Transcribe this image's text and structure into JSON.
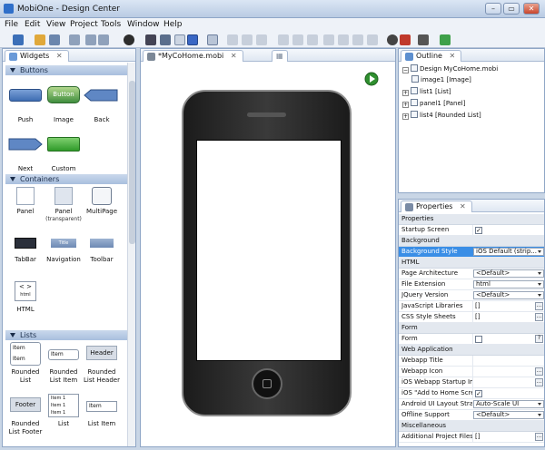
{
  "window": {
    "title": "MobiOne - Design Center"
  },
  "menu": [
    "File",
    "Edit",
    "View",
    "Project",
    "Tools",
    "Window",
    "Help"
  ],
  "widgets_panel": {
    "tab_label": "Widgets",
    "sections": {
      "buttons": {
        "label": "Buttons",
        "items": [
          {
            "label": "Push"
          },
          {
            "label": "Image",
            "thumb_text": "Button"
          },
          {
            "label": "Back"
          },
          {
            "label": "Next"
          },
          {
            "label": "Custom"
          }
        ]
      },
      "containers": {
        "label": "Containers",
        "items": [
          {
            "label": "Panel"
          },
          {
            "label": "Panel",
            "sub": "(transparent)"
          },
          {
            "label": "MultiPage"
          },
          {
            "label": "TabBar"
          },
          {
            "label": "Navigation",
            "thumb_text": "Title"
          },
          {
            "label": "Toolbar"
          },
          {
            "label": "HTML",
            "thumb_text": "< >",
            "thumb_sub": "html"
          }
        ]
      },
      "lists": {
        "label": "Lists",
        "items": [
          {
            "label": "Rounded",
            "label2": "List",
            "rows": [
              "Item",
              "Item"
            ]
          },
          {
            "label": "Rounded",
            "label2": "List Item",
            "rows": [
              "Item"
            ]
          },
          {
            "label": "Rounded",
            "label2": "List Header",
            "thumb_text": "Header"
          },
          {
            "label": "Rounded",
            "label2": "List Footer",
            "thumb_text": "Footer"
          },
          {
            "label": "List",
            "rows": [
              "Item 1",
              "Item 1",
              "Item 1"
            ]
          },
          {
            "label": "List Item",
            "rows": [
              "Item"
            ]
          }
        ]
      }
    }
  },
  "editor": {
    "tab_label": "*MyCoHome.mobi"
  },
  "outline": {
    "tab_label": "Outline",
    "root": "Design MyCoHome.mobi",
    "children": [
      "image1 [Image]",
      "list1 [List]",
      "panel1 [Panel]",
      "list4 [Rounded List]"
    ]
  },
  "properties": {
    "tab_label": "Properties",
    "groups": [
      {
        "name": "Properties",
        "rows": [
          {
            "name": "Startup Screen",
            "type": "check",
            "value": "✓"
          }
        ]
      },
      {
        "name": "Background",
        "rows": [
          {
            "name": "Background Style",
            "type": "dropdown",
            "value": "iOS Default (strip...",
            "selected": true
          }
        ]
      },
      {
        "name": "HTML",
        "rows": [
          {
            "name": "Page Architecture",
            "type": "dropdown",
            "value": "<Default>"
          },
          {
            "name": "File Extension",
            "type": "dropdown",
            "value": "html"
          },
          {
            "name": "JQuery Version",
            "type": "dropdown",
            "value": "<Default>"
          },
          {
            "name": "JavaScript Libraries",
            "type": "ellipsis",
            "value": "[]"
          },
          {
            "name": "CSS Style Sheets",
            "type": "ellipsis",
            "value": "[]"
          }
        ]
      },
      {
        "name": "Form",
        "rows": [
          {
            "name": "Form",
            "type": "check-help",
            "value": ""
          }
        ]
      },
      {
        "name": "Web Application",
        "rows": [
          {
            "name": "Webapp Title",
            "type": "text",
            "value": ""
          },
          {
            "name": "Webapp Icon",
            "type": "ellipsis",
            "value": ""
          },
          {
            "name": "iOS Webapp Startup Im",
            "type": "ellipsis",
            "value": ""
          },
          {
            "name": "iOS \"Add to Home Scre",
            "type": "check",
            "value": "✓"
          },
          {
            "name": "Android UI Layout Strat",
            "type": "dropdown",
            "value": "Auto-Scale UI"
          },
          {
            "name": "Offline Support",
            "type": "dropdown",
            "value": "<Default>"
          }
        ]
      },
      {
        "name": "Miscellaneous",
        "rows": [
          {
            "name": "Additional Project Files",
            "type": "ellipsis",
            "value": "[]"
          }
        ]
      }
    ]
  },
  "colors": {
    "accent": "#3399ff",
    "selection": "#3a8ee6",
    "toolbar_bg": "#eef2f8",
    "panel_border": "#8fa6c6"
  }
}
